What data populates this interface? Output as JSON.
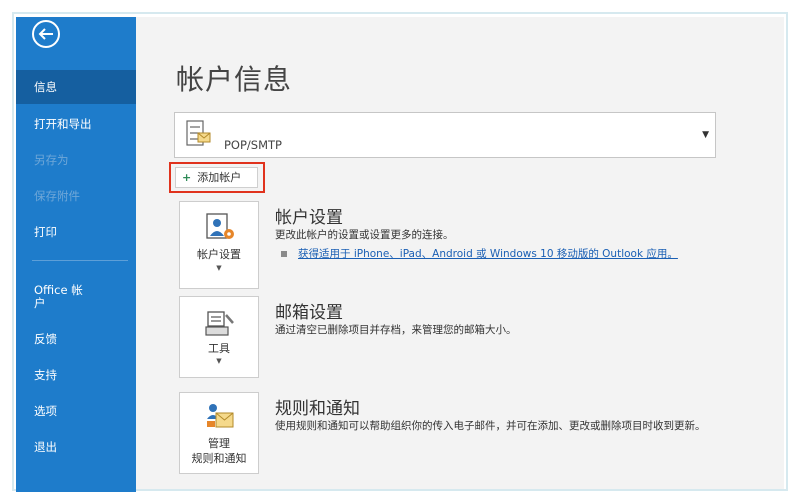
{
  "sidebar": {
    "items": [
      {
        "label": "信息",
        "state": "active"
      },
      {
        "label": "打开和导出",
        "state": "normal"
      },
      {
        "label": "另存为",
        "state": "disabled"
      },
      {
        "label": "保存附件",
        "state": "disabled"
      },
      {
        "label": "打印",
        "state": "normal"
      },
      {
        "label": "Office 帐户",
        "state": "normal"
      },
      {
        "label": "反馈",
        "state": "normal"
      },
      {
        "label": "支持",
        "state": "normal"
      },
      {
        "label": "选项",
        "state": "normal"
      },
      {
        "label": "退出",
        "state": "normal"
      }
    ],
    "office_line1": "Office 帐",
    "office_line2": "户"
  },
  "main": {
    "title": "帐户信息",
    "account_selector": {
      "value": "POP/SMTP"
    },
    "add_account_label": "添加帐户",
    "sections": [
      {
        "tile_label": "帐户设置",
        "title": "帐户设置",
        "description": "更改此帐户的设置或设置更多的连接。",
        "link": "获得适用于 iPhone、iPad、Android 或 Windows 10 移动版的 Outlook 应用。"
      },
      {
        "tile_label": "工具",
        "title": "邮箱设置",
        "description": "通过清空已删除项目并存档，来管理您的邮箱大小。"
      },
      {
        "tile_label_line1": "管理",
        "tile_label_line2": "规则和通知",
        "title": "规则和通知",
        "description": "使用规则和通知可以帮助组织你的传入电子邮件，并可在添加、更改或删除项目时收到更新。"
      }
    ]
  },
  "colors": {
    "sidebar_bg": "#1e7ccb",
    "sidebar_active": "#155fa0",
    "highlight_border": "#e0321d",
    "link": "#1a5fb4"
  }
}
